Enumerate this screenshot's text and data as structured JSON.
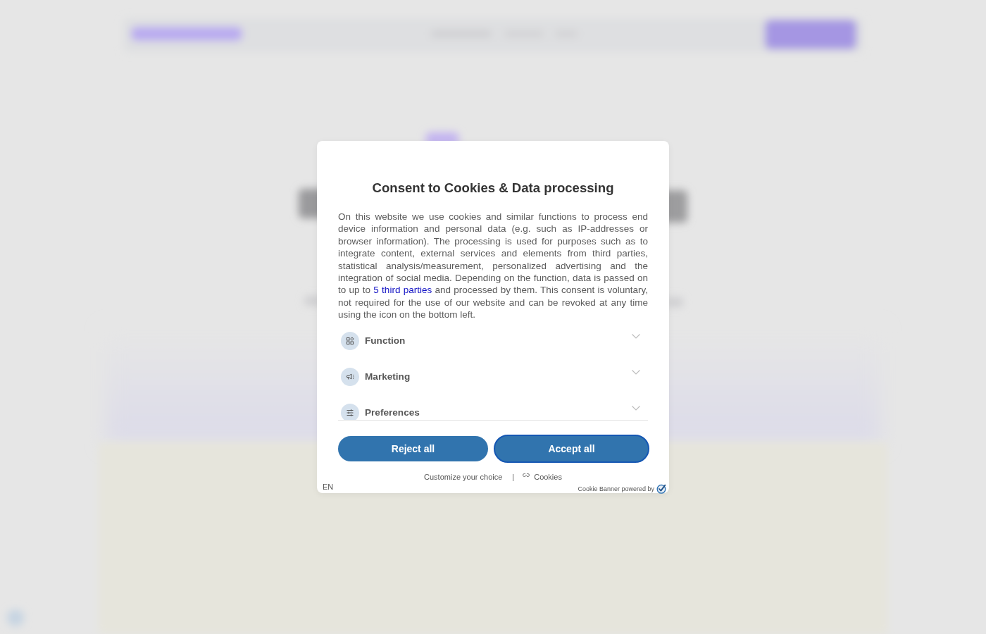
{
  "dialog": {
    "title": "Consent to Cookies & Data processing",
    "description": {
      "before": "On this website we use cookies and similar functions to process end device information and personal data (e.g. such as IP-addresses or browser information). The processing is used for purposes such as to integrate content, external services and elements from third parties, statistical analysis/measurement, personalized advertising and the integration of social media. Depending on the function, data is passed on to up to ",
      "link": "5 third parties",
      "after": " and processed by them. This consent is voluntary, not required for the use of our website and can be revoked at any time using the icon on the bottom left."
    },
    "categories": [
      {
        "label": "Function",
        "expanded": false
      },
      {
        "label": "Marketing",
        "expanded": false
      },
      {
        "label": "Preferences",
        "expanded": false
      }
    ],
    "buttons": [
      {
        "label": "Reject all",
        "focused": false
      },
      {
        "label": "Accept all",
        "focused": true
      }
    ],
    "footer": {
      "customize_link": "Customize your choice",
      "separator": "|",
      "cookies_link": "Cookies",
      "language": "EN",
      "powered_by": "Cookie Banner powered by"
    }
  }
}
